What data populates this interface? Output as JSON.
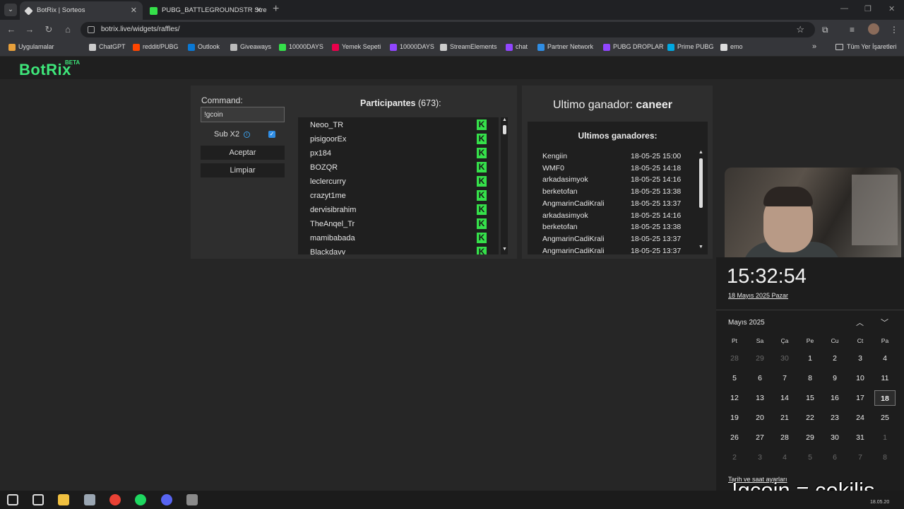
{
  "browser": {
    "tabs": [
      {
        "title": "BotRix | Sorteos",
        "active": true,
        "favicon": "botrix-icon",
        "color": "#d8d8d8"
      },
      {
        "title": "PUBG_BATTLEGROUNDSTR Stre",
        "active": false,
        "favicon": "kick-icon",
        "color": "#35e04a"
      }
    ],
    "url": "botrix.live/widgets/raffles/",
    "bookmarks": [
      {
        "label": "Uygulamalar",
        "color": "#e8a03b"
      },
      {
        "label": "ChatGPT",
        "color": "#cccccc"
      },
      {
        "label": "reddit/PUBG",
        "color": "#ff4500"
      },
      {
        "label": "Outlook",
        "color": "#0a78d4"
      },
      {
        "label": "Giveaways",
        "color": "#bbbbbb"
      },
      {
        "label": "10000DAYS",
        "color": "#35e04a"
      },
      {
        "label": "Yemek Sepeti",
        "color": "#ea004b"
      },
      {
        "label": "10000DAYS",
        "color": "#9146ff"
      },
      {
        "label": "StreamElements",
        "color": "#cccccc"
      },
      {
        "label": "chat",
        "color": "#9146ff"
      },
      {
        "label": "Partner Network",
        "color": "#2f8de4"
      },
      {
        "label": "PUBG DROPLAR",
        "color": "#9146ff"
      },
      {
        "label": "Prime PUBG",
        "color": "#00a8e1"
      },
      {
        "label": "emo",
        "color": "#dddddd"
      }
    ],
    "bookmarks_folder": "Tüm Yer İşaretleri"
  },
  "app": {
    "logo": "BotRix",
    "beta": "BETA",
    "accent": "#3ee67a"
  },
  "raffle": {
    "command_label": "Command:",
    "command_value": "!gcoin",
    "sub_label": "Sub X2",
    "sub_checked": true,
    "accept_label": "Aceptar",
    "clear_label": "Limpiar",
    "participants_label": "Participantes",
    "participants_count": "(673):",
    "participants": [
      "Neoo_TR",
      "pisigoorEx",
      "px184",
      "BOZQR",
      "leclercurry",
      "crazyt1me",
      "dervisibrahim",
      "TheAnqel_Tr",
      "mamibabada",
      "Blackdavy"
    ],
    "winner_label": "Ultimo ganador:",
    "winner_name": "caneer",
    "history_title": "Ultimos ganadores:",
    "history": [
      {
        "name": "Kengiin",
        "time": "18-05-25 15:00"
      },
      {
        "name": "WMF0",
        "time": "18-05-25 14:18"
      },
      {
        "name": "arkadasimyok",
        "time": "18-05-25 14:16"
      },
      {
        "name": "berketofan",
        "time": "18-05-25 13:38"
      },
      {
        "name": "AngmarinCadiKrali",
        "time": "18-05-25 13:37"
      },
      {
        "name": "arkadasimyok",
        "time": "18-05-25 14:16"
      },
      {
        "name": "berketofan",
        "time": "18-05-25 13:38"
      },
      {
        "name": "AngmarinCadiKrali",
        "time": "18-05-25 13:37"
      },
      {
        "name": "AngmarinCadiKrali",
        "time": "18-05-25 13:37"
      }
    ]
  },
  "clock": {
    "time": "15:32:54",
    "date": "18 Mayıs 2025 Pazar",
    "month": "Mayıs 2025",
    "weekdays": [
      "Pt",
      "Sa",
      "Ça",
      "Pe",
      "Cu",
      "Ct",
      "Pa"
    ],
    "weeks": [
      [
        "28",
        "29",
        "30",
        "1",
        "2",
        "3",
        "4"
      ],
      [
        "5",
        "6",
        "7",
        "8",
        "9",
        "10",
        "11"
      ],
      [
        "12",
        "13",
        "14",
        "15",
        "16",
        "17",
        "18"
      ],
      [
        "19",
        "20",
        "21",
        "22",
        "23",
        "24",
        "25"
      ],
      [
        "26",
        "27",
        "28",
        "29",
        "30",
        "31",
        "1"
      ],
      [
        "2",
        "3",
        "4",
        "5",
        "6",
        "7",
        "8"
      ]
    ],
    "today": "18",
    "settings_link": "Tarih ve saat ayarları"
  },
  "overlay_text": "!gcoin = çekiliş",
  "taskbar": {
    "apps": [
      {
        "name": "windows-start-icon",
        "color": "#dddddd"
      },
      {
        "name": "search-icon",
        "color": "#dddddd"
      },
      {
        "name": "file-explorer-icon",
        "color": "#f0c040"
      },
      {
        "name": "app-icon",
        "color": "#9aa6b2"
      },
      {
        "name": "chrome-icon",
        "color": "#e94235"
      },
      {
        "name": "spotify-icon",
        "color": "#1ed760"
      },
      {
        "name": "discord-icon",
        "color": "#5865f2"
      },
      {
        "name": "pubg-icon",
        "color": "#8a8a8a"
      }
    ],
    "tray_date": "18.05.20"
  }
}
